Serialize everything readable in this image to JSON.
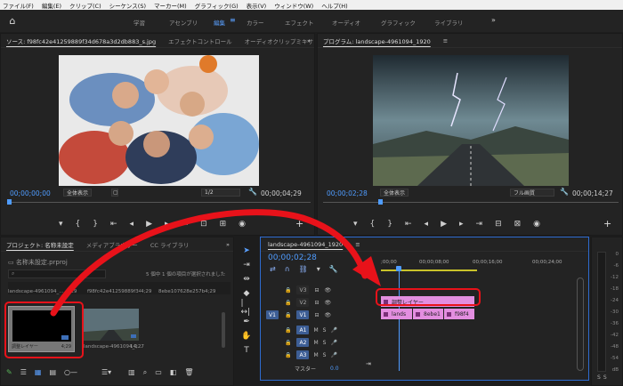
{
  "menu": [
    "ファイル(F)",
    "編集(E)",
    "クリップ(C)",
    "シーケンス(S)",
    "マーカー(M)",
    "グラフィック(G)",
    "表示(V)",
    "ウィンドウ(W)",
    "ヘルプ(H)"
  ],
  "workspaces": [
    "学習",
    "アセンブリ",
    "編集",
    "カラー",
    "エフェクト",
    "オーディオ",
    "グラフィック",
    "ライブラリ"
  ],
  "source": {
    "tab_source": "ソース: f98fc42e41259889f34d678a3d2db883_s.jpg",
    "tab_effect": "エフェクトコントロール",
    "tab_audio": "オーディオクリップミキサ",
    "tc_in": "00;00;00;00",
    "zoom": "全体表示",
    "ratio": "1/2",
    "tc_dur": "00;00;04;29"
  },
  "program": {
    "tab": "プログラム: landscape-4961094_1920",
    "tc_in": "00;00;02;28",
    "zoom": "全体表示",
    "quality": "フル画質",
    "tc_dur": "00;00;14;27"
  },
  "project": {
    "tab_project": "プロジェクト: 名称未設定",
    "tab_media": "メディアブラウザー",
    "tab_library": "CC ライブラリ",
    "file": "名称未設定.prproj",
    "count": "5 個中 1 個の項目が選択されました",
    "row1": [
      "landscape-4961094_...",
      "4;29",
      "f98fc42e41259889f34d678...",
      "4;29",
      "8ebe107628e257b67...",
      "4;29"
    ],
    "row2": [
      "調整レイヤー",
      "4;29",
      "landscape-4961094_1...",
      "14;27"
    ]
  },
  "timeline": {
    "tab": "landscape-4961094_1920",
    "tc": "00;00;02;28",
    "ruler": [
      ";00;00",
      "00;00;08;00",
      "00;00;16;00",
      "00;00;24;00"
    ],
    "video_tracks": [
      "V3",
      "V2",
      "V1"
    ],
    "audio_tracks": [
      "A1",
      "A2",
      "A3"
    ],
    "master": "マスター",
    "master_val": "0.0",
    "clip_adjust": "調整レイヤー",
    "clips_v1": [
      "lands",
      "8ebe1",
      "f98f4"
    ]
  },
  "meter_scale": [
    "0",
    "-6",
    "-12",
    "-18",
    "-24",
    "-30",
    "-36",
    "-42",
    "-48",
    "-54",
    "dB"
  ]
}
